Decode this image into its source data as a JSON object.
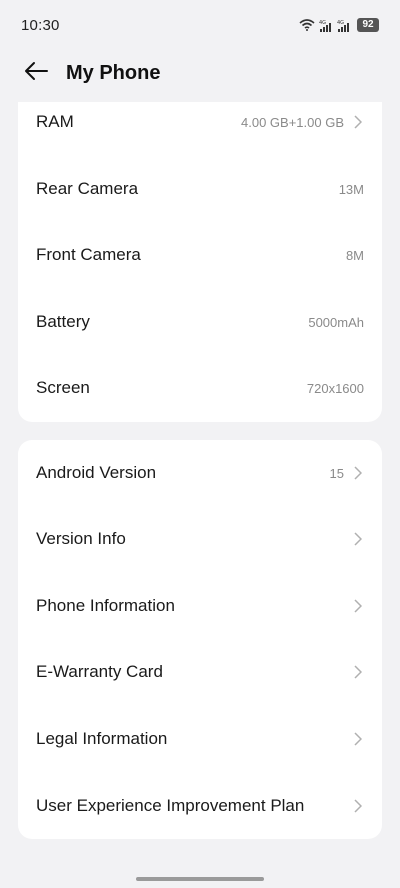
{
  "status_bar": {
    "time": "10:30",
    "battery": "92",
    "network_1": "4G",
    "network_2": "4G"
  },
  "header": {
    "title": "My Phone"
  },
  "specs": [
    {
      "label": "RAM",
      "value": "4.00 GB+1.00 GB",
      "chevron": true
    },
    {
      "label": "Rear Camera",
      "value": "13M",
      "chevron": false
    },
    {
      "label": "Front Camera",
      "value": "8M",
      "chevron": false
    },
    {
      "label": "Battery",
      "value": "5000mAh",
      "chevron": false
    },
    {
      "label": "Screen",
      "value": "720x1600",
      "chevron": false
    }
  ],
  "menu": [
    {
      "label": "Android Version",
      "value": "15",
      "chevron": true
    },
    {
      "label": "Version Info",
      "value": "",
      "chevron": true
    },
    {
      "label": "Phone Information",
      "value": "",
      "chevron": true
    },
    {
      "label": "E-Warranty Card",
      "value": "",
      "chevron": true
    },
    {
      "label": "Legal Information",
      "value": "",
      "chevron": true
    },
    {
      "label": "User Experience Improvement Plan",
      "value": "",
      "chevron": true
    }
  ],
  "colors": {
    "background": "#f2f2f4",
    "card": "#ffffff",
    "label": "#1a1a1a",
    "value": "#8a8a8a",
    "chevron": "#b0b0b0"
  }
}
